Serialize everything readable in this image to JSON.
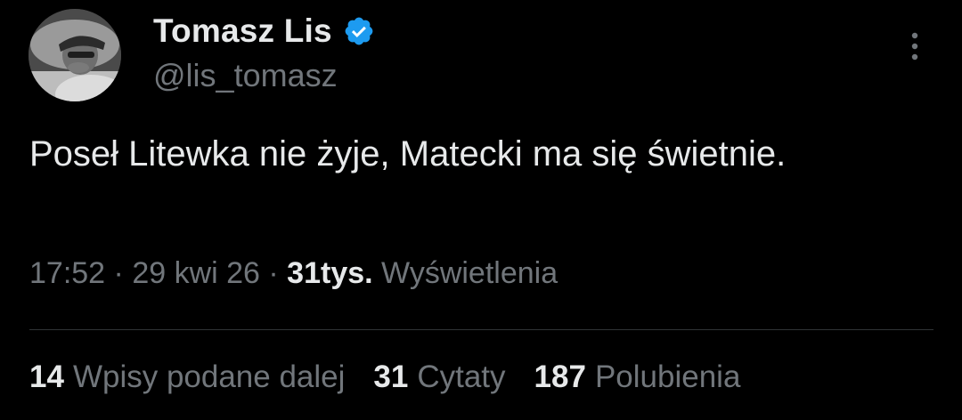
{
  "author": {
    "display_name": "Tomasz Lis",
    "handle": "@lis_tomasz",
    "verified": true
  },
  "tweet": {
    "text": "Poseł Litewka nie żyje, Matecki ma się świetnie."
  },
  "meta": {
    "time": "17:52",
    "sep1": " · ",
    "date": "29 kwi 26",
    "sep2": " · ",
    "views_count": "31tys.",
    "views_label": " Wyświetlenia"
  },
  "stats": {
    "reposts_count": "14",
    "reposts_label": "Wpisy podane dalej",
    "quotes_count": "31",
    "quotes_label": "Cytaty",
    "likes_count": "187",
    "likes_label": "Polubienia"
  },
  "icons": {
    "verified": "verified-badge-icon",
    "more": "more-vertical-icon"
  },
  "colors": {
    "background": "#000000",
    "primary_text": "#e7e9ea",
    "secondary_text": "#71767b",
    "verified_blue": "#1d9bf0",
    "divider": "#2f3336"
  }
}
